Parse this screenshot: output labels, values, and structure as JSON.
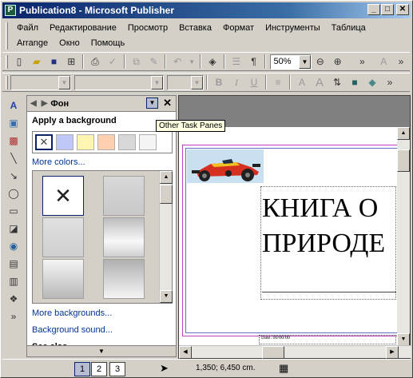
{
  "window": {
    "title": "Publication8 - Microsoft Publisher",
    "app_icon": "publisher-icon"
  },
  "menu": {
    "row1": [
      "Файл",
      "Редактирование",
      "Просмотр",
      "Вставка",
      "Формат",
      "Инструменты",
      "Таблица"
    ],
    "row2": [
      "Arrange",
      "Окно",
      "Помощь"
    ]
  },
  "toolbar": {
    "zoom": "50%"
  },
  "task_pane": {
    "title": "Фон",
    "section_title": "Apply a background",
    "swatch_colors": [
      "#ffffff",
      "#c0c8f8",
      "#fff4b0",
      "#ffd0b0",
      "#d8d8d8",
      "#f4f4f4"
    ],
    "more_colors": "More colors...",
    "more_backgrounds": "More backgrounds...",
    "background_sound": "Background sound...",
    "see_also": "See also",
    "tooltip": "Other Task Panes"
  },
  "document": {
    "headline_line1": "КНИГА О",
    "headline_line2": "ПРИРОДЕ",
    "date_text": "Date: 00/00/00"
  },
  "status": {
    "pages": [
      "1",
      "2",
      "3"
    ],
    "active_page": "1",
    "coords": "1,350; 6,450 cm."
  }
}
